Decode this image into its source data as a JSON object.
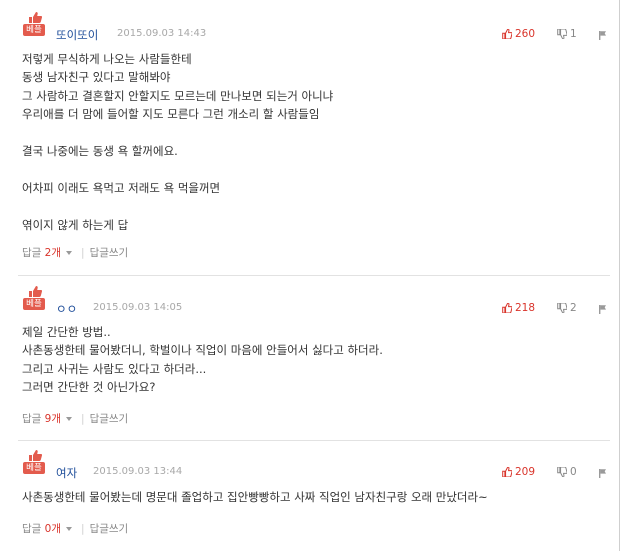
{
  "comments": [
    {
      "best_tag": "베플",
      "nickname": "또이또이",
      "date": "2015.09.03 14:43",
      "likes": "260",
      "dislikes": "1",
      "lines": [
        "저렇게 무식하게 나오는 사람들한테",
        "동생 남자친구 있다고 말해봐야",
        "그 사람하고 결혼할지 안할지도 모르는데 만나보면 되는거 아니냐",
        "우리애를 더 맘에 들어할 지도 모른다 그런 개소리 할 사람들임",
        "",
        "결국 나중에는 동생 욕 할꺼에요.",
        "",
        "어차피 이래도 욕먹고 저래도 욕 먹을꺼면",
        "",
        "엮이지 않게 하는게 답"
      ],
      "reply_label": "답글",
      "reply_count": "2개",
      "write_label": "답글쓰기"
    },
    {
      "best_tag": "베플",
      "nickname": "ㅇㅇ",
      "date": "2015.09.03 14:05",
      "likes": "218",
      "dislikes": "2",
      "lines": [
        "제일 간단한 방법..",
        "사촌동생한테 물어봤더니, 학벌이나 직업이 마음에 안들어서 싫다고 하더라.",
        "그리고 사귀는 사람도 있다고 하더라...",
        "그러면 간단한 것 아닌가요?"
      ],
      "reply_label": "답글",
      "reply_count": "9개",
      "write_label": "답글쓰기"
    },
    {
      "best_tag": "베플",
      "nickname": "여자",
      "date": "2015.09.03 13:44",
      "likes": "209",
      "dislikes": "0",
      "lines": [
        "사촌동생한테 물어봤는데 명문대 졸업하고 집안빵빵하고 사짜 직업인 남자친구랑 오래 만났더라~"
      ],
      "reply_label": "답글",
      "reply_count": "0개",
      "write_label": "답글쓰기"
    }
  ],
  "icons": {
    "best": "best-thumb-icon",
    "like": "thumbs-up-icon",
    "dislike": "thumbs-down-icon",
    "report": "report-icon",
    "expand": "caret-down-icon"
  },
  "colors": {
    "best_tag_bg": "#e35b4d",
    "like": "#d9342b",
    "nickname": "#1f4e9a",
    "reply_count": "#d9342b",
    "muted": "#888888"
  }
}
